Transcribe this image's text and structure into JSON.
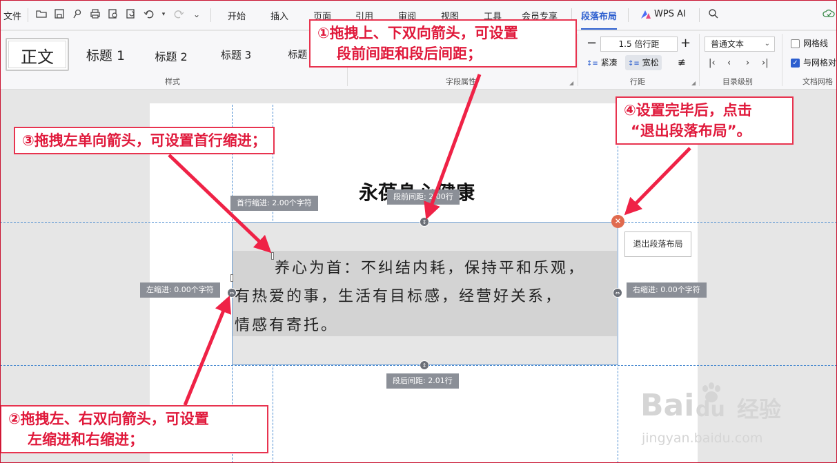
{
  "menubar": {
    "file": "文件",
    "tabs": [
      "开始",
      "插入",
      "页面",
      "引用",
      "审阅",
      "视图",
      "工具",
      "会员专享",
      "段落布局"
    ],
    "active_tab": "段落布局",
    "wps_ai": "WPS AI"
  },
  "ribbon": {
    "styles": [
      "正文",
      "标题 1",
      "标题 2",
      "标题 3",
      "标题 4"
    ],
    "styles_label": "样式",
    "font_attr_label": "字段属性",
    "line_spacing": "1.5 倍行距",
    "compact": "紧凑",
    "loose": "宽松",
    "line_spacing_label": "行距",
    "toc_level_value": "普通文本",
    "toc_level_label": "目录级别",
    "gridlines": "网格线",
    "align_grid": "与网格对",
    "doc_grid_label": "文档网格"
  },
  "document": {
    "title": "永葆身心健康",
    "lines": [
      "养心为首：不纠结内耗，保持平和乐观，",
      "有热爱的事，生活有目标感，经营好关系，",
      "情感有寄托。"
    ],
    "space_before": "段前间距: 2.00行",
    "first_indent": "首行缩进: 2.00个字符",
    "left_indent": "左缩进: 0.00个字符",
    "right_indent": "右缩进: 0.00个字符",
    "space_after": "段后间距: 2.01行",
    "exit_button": "退出段落布局"
  },
  "annotations": {
    "c1_line1": "①拖拽上、下双向箭头，可设置",
    "c1_line2": "段前间距和段后间距；",
    "c2_line1": "②拖拽左、右双向箭头，可设置",
    "c2_line2": "左缩进和右缩进；",
    "c3": "③拖拽左单向箭头，可设置首行缩进；",
    "c4_line1": "④设置完毕后，点击",
    "c4_line2": "“退出段落布局”。"
  },
  "watermark": {
    "brand": "Bai",
    "brand_du": "du",
    "brand_cn": "经验",
    "url": "jingyan.baidu.com"
  },
  "colors": {
    "accent": "#2c5ecf",
    "annotation": "#e0193b",
    "guide": "#4a8bd0"
  }
}
